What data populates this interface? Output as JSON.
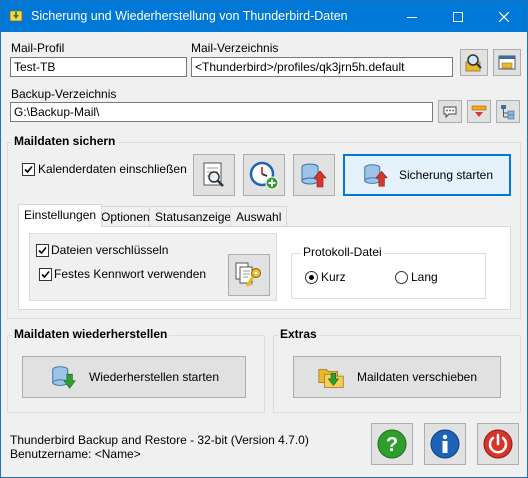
{
  "window": {
    "title": "Sicherung und Wiederherstellung von Thunderbird-Daten"
  },
  "mail_profile": {
    "label": "Mail-Profil",
    "value": "Test-TB"
  },
  "mail_dir": {
    "label": "Mail-Verzeichnis",
    "value": "<Thunderbird>/profiles/qk3jrn5h.default"
  },
  "backup_dir": {
    "label": "Backup-Verzeichnis",
    "value": "G:\\Backup-Mail\\"
  },
  "backup_section": {
    "title": "Maildaten sichern",
    "calendar_checkbox": "Kalenderdaten einschließen",
    "calendar_checked": true,
    "start_button": "Sicherung starten"
  },
  "tabs": [
    "Einstellungen",
    "Optionen",
    "Statusanzeige",
    "Auswahl"
  ],
  "settings": {
    "encrypt_label": "Dateien verschlüsseln",
    "encrypt_checked": true,
    "password_label": "Festes Kennwort verwenden",
    "password_checked": true,
    "logfile_title": "Protokoll-Datei",
    "short_label": "Kurz",
    "long_label": "Lang",
    "selected_log": "Kurz"
  },
  "restore_section": {
    "title": "Maildaten wiederherstellen",
    "button": "Wiederherstellen starten"
  },
  "extras_section": {
    "title": "Extras",
    "button": "Maildaten verschieben"
  },
  "footer": {
    "version": "Thunderbird Backup and Restore - 32-bit (Version 4.7.0)",
    "username": "Benutzername:  <Name>"
  },
  "colors": {
    "titlebar": "#0078d7",
    "help_green": "#2e9e2e",
    "info_blue": "#1e63b8",
    "power_red": "#d9342b"
  }
}
